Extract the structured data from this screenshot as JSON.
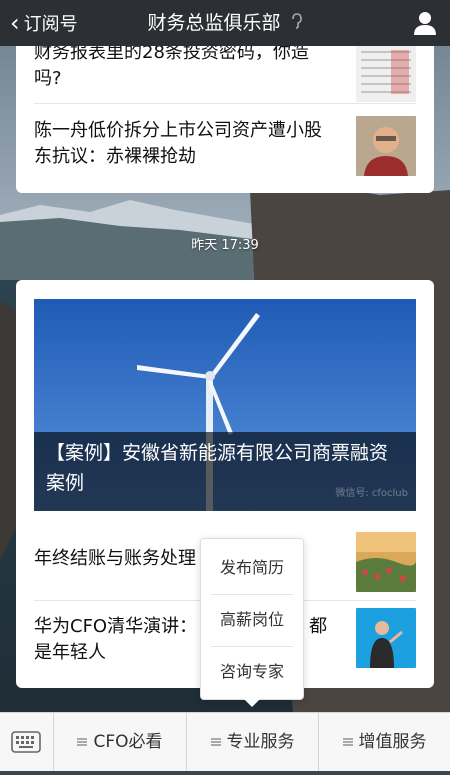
{
  "header": {
    "back_label": "订阅号",
    "title": "财务总监俱乐部"
  },
  "feed": {
    "top_card": {
      "item1_title": "财务报表里的28条投资密码，你造吗?",
      "item2_title": "陈一舟低价拆分上市公司资产遭小股东抗议：赤裸裸抢劫"
    },
    "time_label": "昨天 17:39",
    "second_card": {
      "hero_caption": "【案例】安徽省新能源有限公司商票融资案例",
      "watermark": "微信号: cfoclub",
      "item1_title": "年终结账与账务处理",
      "item2_title": "华为CFO清华演讲：",
      "item2_title_cont": "都",
      "item2_title_line2": "是年轻人"
    }
  },
  "popup_menu": {
    "items": [
      "发布简历",
      "高薪岗位",
      "咨询专家"
    ]
  },
  "bottom_bar": {
    "menus": [
      "CFO必看",
      "专业服务",
      "增值服务"
    ]
  },
  "colors": {
    "header_bg": "#2c2f33",
    "bottom_bg": "#f7f7f7",
    "card_bg": "#ffffff"
  }
}
